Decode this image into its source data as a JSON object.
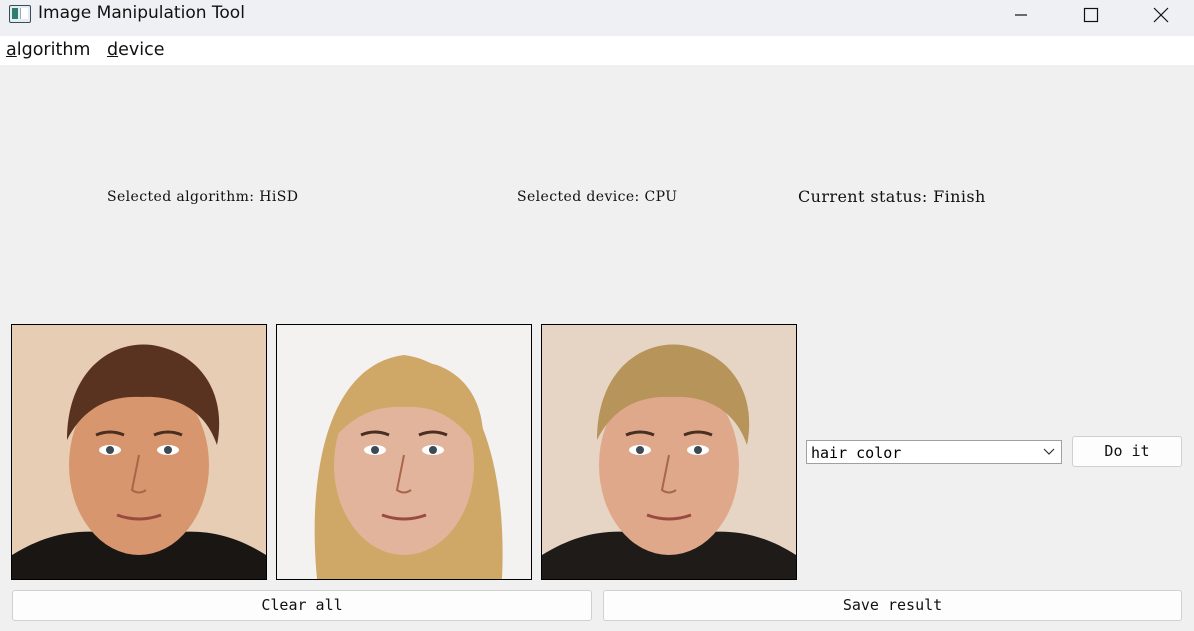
{
  "window": {
    "title": "Image Manipulation Tool",
    "controls": [
      "minimize-icon",
      "maximize-icon",
      "close-icon"
    ]
  },
  "menubar": {
    "algorithm": {
      "mnemonic": "a",
      "rest": "lgorithm"
    },
    "device": {
      "mnemonic": "d",
      "rest": "evice"
    }
  },
  "status": {
    "algorithm": "Selected algorithm: HiSD",
    "device": "Selected device: CPU",
    "current": "Current status: Finish"
  },
  "images": [
    {
      "role": "source",
      "hair": "#5a3320",
      "skin": "#d8966e",
      "bg": "#e6cdb4",
      "shirt": "#1a1614"
    },
    {
      "role": "reference",
      "hair": "#cfa868",
      "skin": "#e3b49c",
      "bg": "#f4f2f0",
      "shirt": "#f4f2f0"
    },
    {
      "role": "result",
      "hair": "#b6945a",
      "skin": "#e0a88a",
      "bg": "#e6d5c4",
      "shirt": "#1f1b19"
    }
  ],
  "controls": {
    "attribute_selected": "hair color",
    "do_it_label": "Do it",
    "clear_label": "Clear all",
    "save_label": "Save result"
  }
}
